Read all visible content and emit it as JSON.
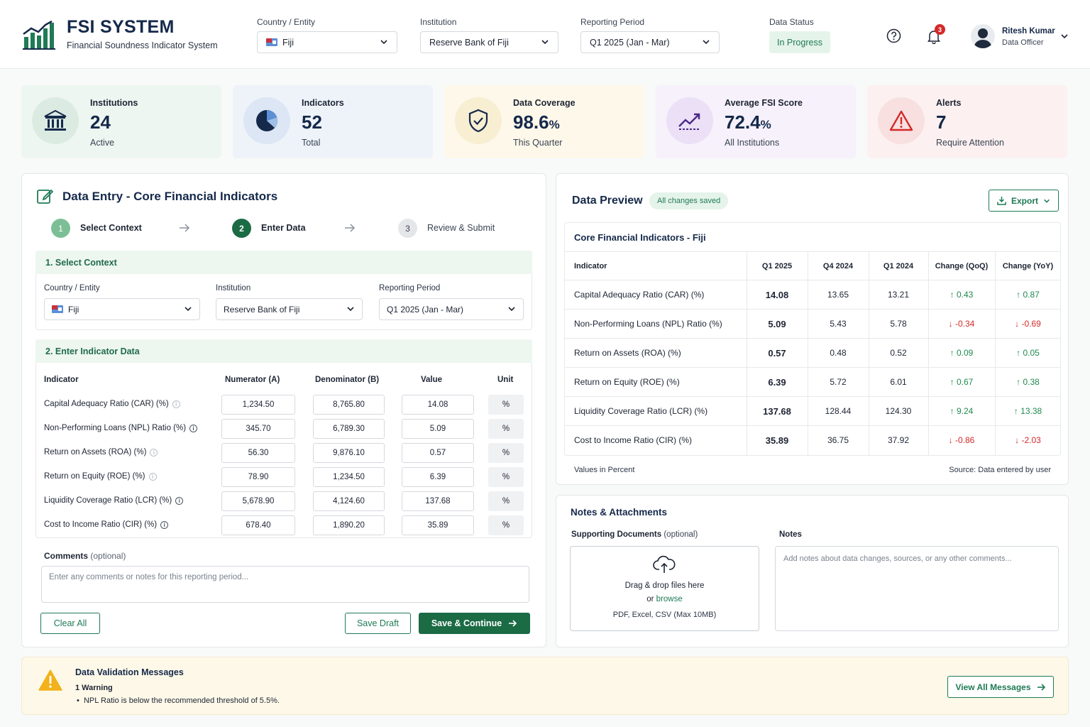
{
  "app": {
    "title": "FSI SYSTEM",
    "subtitle": "Financial Soundness Indicator System"
  },
  "header": {
    "country_label": "Country / Entity",
    "country_value": "Fiji",
    "institution_label": "Institution",
    "institution_value": "Reserve Bank of Fiji",
    "period_label": "Reporting Period",
    "period_value": "Q1 2025 (Jan - Mar)",
    "status_label": "Data Status",
    "status_value": "In Progress",
    "notification_count": "3",
    "user_name": "Ritesh Kumar",
    "user_role": "Data Officer"
  },
  "stats": [
    {
      "title": "Institutions",
      "value": "24",
      "unit": "",
      "sub": "Active",
      "icon": "bank-icon",
      "color": "#1f7a55"
    },
    {
      "title": "Indicators",
      "value": "52",
      "unit": "",
      "sub": "Total",
      "icon": "pie-chart-icon",
      "color": "#15294a"
    },
    {
      "title": "Data Coverage",
      "value": "98.6",
      "unit": "%",
      "sub": "This Quarter",
      "icon": "shield-check-icon",
      "color": "#15294a"
    },
    {
      "title": "Average FSI Score",
      "value": "72.4",
      "unit": "%",
      "sub": "All Institutions",
      "icon": "trend-up-icon",
      "color": "#4a2a8a"
    },
    {
      "title": "Alerts",
      "value": "7",
      "unit": "",
      "sub": "Require Attention",
      "icon": "warning-icon",
      "color": "#d42a2a"
    }
  ],
  "entry": {
    "title": "Data Entry - Core Financial Indicators",
    "steps": [
      {
        "num": "1",
        "label": "Select Context"
      },
      {
        "num": "2",
        "label": "Enter Data"
      },
      {
        "num": "3",
        "label": "Review & Submit"
      }
    ],
    "context_title": "1. Select Context",
    "country_label": "Country / Entity",
    "country_value": "Fiji",
    "institution_label": "Institution",
    "institution_value": "Reserve Bank of Fiji",
    "period_label": "Reporting Period",
    "period_value": "Q1 2025 (Jan - Mar)",
    "data_title": "2. Enter Indicator Data",
    "columns": [
      "Indicator",
      "Numerator (A)",
      "Denominator (B)",
      "Value",
      "Unit"
    ],
    "rows": [
      {
        "name": "Capital Adequacy Ratio (CAR) (%)",
        "num": "1,234.50",
        "den": "8,765.80",
        "val": "14.08",
        "unit": "%"
      },
      {
        "name": "Non-Performing Loans (NPL) Ratio (%)",
        "num": "345.70",
        "den": "6,789.30",
        "val": "5.09",
        "unit": "%"
      },
      {
        "name": "Return on Assets (ROA) (%)",
        "num": "56.30",
        "den": "9,876.10",
        "val": "0.57",
        "unit": "%"
      },
      {
        "name": "Return on Equity (ROE) (%)",
        "num": "78.90",
        "den": "1,234.50",
        "val": "6.39",
        "unit": "%"
      },
      {
        "name": "Liquidity Coverage Ratio (LCR) (%)",
        "num": "5,678.90",
        "den": "4,124.60",
        "val": "137.68",
        "unit": "%"
      },
      {
        "name": "Cost to Income Ratio (CIR) (%)",
        "num": "678.40",
        "den": "1,890.20",
        "val": "35.89",
        "unit": "%"
      }
    ],
    "comments_label": "Comments",
    "comments_optional": "(optional)",
    "comments_placeholder": "Enter any comments or notes for this reporting period...",
    "clear_label": "Clear All",
    "draft_label": "Save Draft",
    "continue_label": "Save & Continue"
  },
  "preview": {
    "title": "Data Preview",
    "saved_badge": "All changes saved",
    "export_label": "Export",
    "table_title": "Core Financial Indicators - Fiji",
    "columns": [
      "Indicator",
      "Q1 2025",
      "Q4 2024",
      "Q1 2024",
      "Change (QoQ)",
      "Change (YoY)"
    ],
    "rows": [
      {
        "name": "Capital Adequacy Ratio (CAR) (%)",
        "q1_25": "14.08",
        "q4_24": "13.65",
        "q1_24": "13.21",
        "qoq": "0.43",
        "qoq_dir": "up",
        "yoy": "0.87",
        "yoy_dir": "up"
      },
      {
        "name": "Non-Performing Loans (NPL) Ratio (%)",
        "q1_25": "5.09",
        "q4_24": "5.43",
        "q1_24": "5.78",
        "qoq": "-0.34",
        "qoq_dir": "down",
        "yoy": "-0.69",
        "yoy_dir": "down"
      },
      {
        "name": "Return on Assets (ROA) (%)",
        "q1_25": "0.57",
        "q4_24": "0.48",
        "q1_24": "0.52",
        "qoq": "0.09",
        "qoq_dir": "up",
        "yoy": "0.05",
        "yoy_dir": "up"
      },
      {
        "name": "Return on Equity (ROE) (%)",
        "q1_25": "6.39",
        "q4_24": "5.72",
        "q1_24": "6.01",
        "qoq": "0.67",
        "qoq_dir": "up",
        "yoy": "0.38",
        "yoy_dir": "up"
      },
      {
        "name": "Liquidity Coverage Ratio (LCR) (%)",
        "q1_25": "137.68",
        "q4_24": "128.44",
        "q1_24": "124.30",
        "qoq": "9.24",
        "qoq_dir": "up",
        "yoy": "13.38",
        "yoy_dir": "up"
      },
      {
        "name": "Cost to Income Ratio (CIR) (%)",
        "q1_25": "35.89",
        "q4_24": "36.75",
        "q1_24": "37.92",
        "qoq": "-0.86",
        "qoq_dir": "down",
        "yoy": "-2.03",
        "yoy_dir": "down"
      }
    ],
    "footer_left": "Values in Percent",
    "footer_right": "Source: Data entered by user"
  },
  "notes": {
    "title": "Notes & Attachments",
    "docs_label": "Supporting Documents",
    "docs_optional": "(optional)",
    "drop_text": "Drag & drop files here",
    "or_text": "or",
    "browse_text": "browse",
    "formats": "PDF, Excel, CSV (Max 10MB)",
    "notes_label": "Notes",
    "notes_placeholder": "Add notes about data changes, sources, or any other comments..."
  },
  "validation": {
    "title": "Data Validation Messages",
    "count": "1 Warning",
    "message": "NPL Ratio is below the recommended threshold of 5.5%.",
    "button": "View All Messages"
  },
  "colors": {
    "accent": "#1b6b45",
    "up": "#1f8a4f",
    "down": "#d42a2a",
    "navy": "#15294a"
  }
}
